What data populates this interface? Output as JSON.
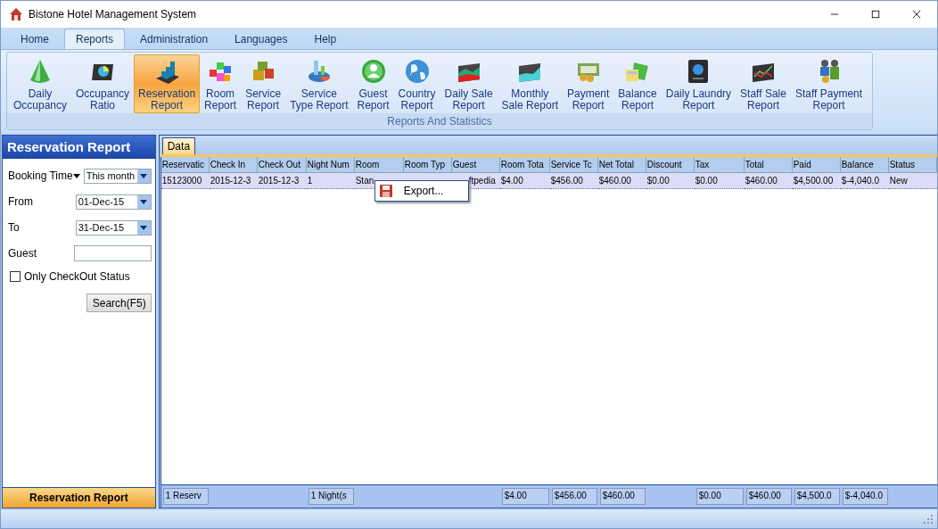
{
  "window": {
    "title": "Bistone Hotel Management System"
  },
  "menu_tabs": [
    {
      "label": "Home",
      "selected": false
    },
    {
      "label": "Reports",
      "selected": true
    },
    {
      "label": "Administration",
      "selected": false
    },
    {
      "label": "Languages",
      "selected": false
    },
    {
      "label": "Help",
      "selected": false
    }
  ],
  "ribbon": {
    "group_label": "Reports And Statistics",
    "items": [
      {
        "lines": [
          "Daily",
          "Occupancy"
        ],
        "selected": false
      },
      {
        "lines": [
          "Occupancy",
          "Ratio"
        ],
        "selected": false
      },
      {
        "lines": [
          "Reservation",
          "Report"
        ],
        "selected": true
      },
      {
        "lines": [
          "Room",
          "Report"
        ],
        "selected": false
      },
      {
        "lines": [
          "Service",
          "Report"
        ],
        "selected": false
      },
      {
        "lines": [
          "Service",
          "Type Report"
        ],
        "selected": false
      },
      {
        "lines": [
          "Guest",
          "Report"
        ],
        "selected": false
      },
      {
        "lines": [
          "Country",
          "Report"
        ],
        "selected": false
      },
      {
        "lines": [
          "Daily Sale",
          "Report"
        ],
        "selected": false
      },
      {
        "lines": [
          "Monthly",
          "Sale Report"
        ],
        "selected": false
      },
      {
        "lines": [
          "Payment",
          "Report"
        ],
        "selected": false
      },
      {
        "lines": [
          "Balance",
          "Report"
        ],
        "selected": false
      },
      {
        "lines": [
          "Daily Laundry",
          "Report"
        ],
        "selected": false
      },
      {
        "lines": [
          "Staff Sale",
          "Report"
        ],
        "selected": false
      },
      {
        "lines": [
          "Staff Payment",
          "Report"
        ],
        "selected": false
      }
    ]
  },
  "side_panel": {
    "title": "Reservation Report",
    "booking_time": {
      "label": "Booking Time",
      "value": "This month"
    },
    "from": {
      "label": "From",
      "value": "01-Dec-15"
    },
    "to": {
      "label": "To",
      "value": "31-Dec-15"
    },
    "guest": {
      "label": "Guest"
    },
    "only_checkout": {
      "label": "Only CheckOut Status",
      "checked": false
    },
    "search_button": "Search(F5)",
    "footer": "Reservation Report"
  },
  "data_tabs": [
    {
      "label": "Data",
      "selected": true
    }
  ],
  "table": {
    "columns": [
      "Reservatic",
      "Check In",
      "Check Out",
      "Night Num",
      "Room",
      "Room Typ",
      "Guest",
      "Room Tota",
      "Service Tc",
      "Net Total",
      "Discount",
      "Tax",
      "Total",
      "Paid",
      "Balance",
      "Status"
    ],
    "rows": [
      {
        "selected": true,
        "cells": [
          {
            "kind": "text",
            "text": "15123000"
          },
          {
            "kind": "text",
            "text": "2015-12-3"
          },
          {
            "kind": "text",
            "text": "2015-12-3"
          },
          {
            "kind": "text",
            "text": "1"
          },
          {
            "kind": "text",
            "text": "Stan"
          },
          {
            "kind": "blank"
          },
          {
            "kind": "partly_covered",
            "text": "ftpedia"
          },
          {
            "kind": "text",
            "text": "$4.00"
          },
          {
            "kind": "text",
            "text": "$456.00"
          },
          {
            "kind": "text",
            "text": "$460.00"
          },
          {
            "kind": "text",
            "text": "$0.00"
          },
          {
            "kind": "text",
            "text": "$0.00"
          },
          {
            "kind": "text",
            "text": "$460.00"
          },
          {
            "kind": "text",
            "text": "$4,500.00"
          },
          {
            "kind": "text",
            "text": "$-4,040.0"
          },
          {
            "kind": "text",
            "text": "New"
          }
        ]
      }
    ],
    "summary": [
      {
        "kind": "value",
        "text": "1 Reserv"
      },
      {
        "kind": "blank"
      },
      {
        "kind": "blank"
      },
      {
        "kind": "value",
        "text": "1 Night(s"
      },
      {
        "kind": "blank"
      },
      {
        "kind": "blank"
      },
      {
        "kind": "blank"
      },
      {
        "kind": "value",
        "text": "$4.00"
      },
      {
        "kind": "value",
        "text": "$456.00"
      },
      {
        "kind": "value",
        "text": "$460.00"
      },
      {
        "kind": "blank"
      },
      {
        "kind": "value",
        "text": "$0.00"
      },
      {
        "kind": "value",
        "text": "$460.00"
      },
      {
        "kind": "value",
        "text": "$4,500.0"
      },
      {
        "kind": "value",
        "text": "$-4,040.0"
      },
      {
        "kind": "blank"
      }
    ]
  },
  "context_menu": {
    "items": [
      "Export..."
    ]
  }
}
